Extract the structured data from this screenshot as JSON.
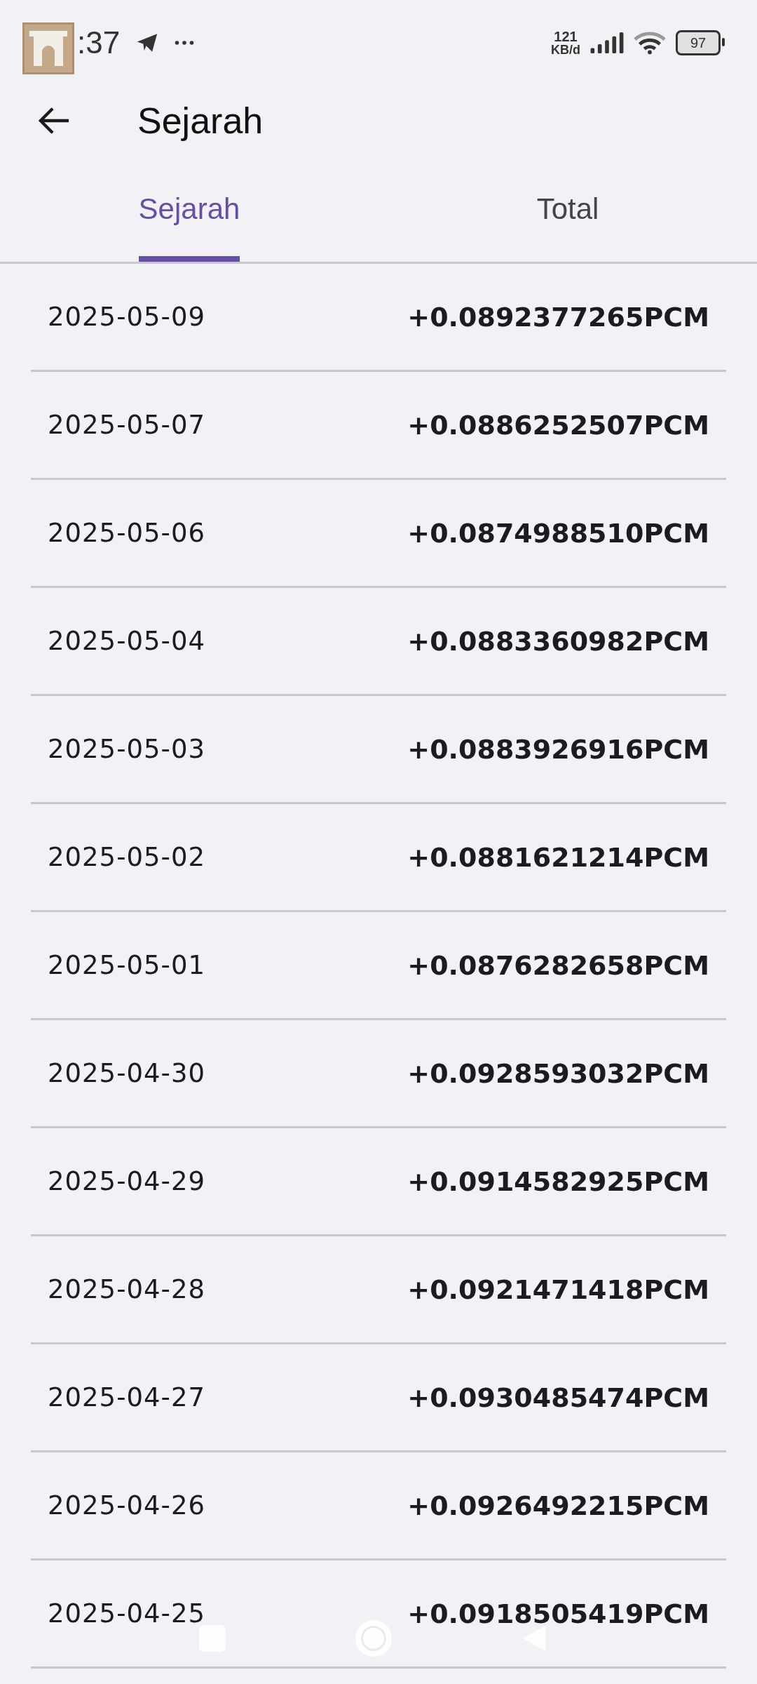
{
  "status_bar": {
    "time": ":37",
    "net_speed": "121",
    "net_unit": "KB/d",
    "battery": "97"
  },
  "toolbar": {
    "title": "Sejarah"
  },
  "tabs": [
    {
      "label": "Sejarah",
      "selected": true
    },
    {
      "label": "Total",
      "selected": false
    }
  ],
  "rows": [
    {
      "date": "2025-05-09",
      "amount": "+0.0892377265PCM"
    },
    {
      "date": "2025-05-07",
      "amount": "+0.0886252507PCM"
    },
    {
      "date": "2025-05-06",
      "amount": "+0.0874988510PCM"
    },
    {
      "date": "2025-05-04",
      "amount": "+0.0883360982PCM"
    },
    {
      "date": "2025-05-03",
      "amount": "+0.0883926916PCM"
    },
    {
      "date": "2025-05-02",
      "amount": "+0.0881621214PCM"
    },
    {
      "date": "2025-05-01",
      "amount": "+0.0876282658PCM"
    },
    {
      "date": "2025-04-30",
      "amount": "+0.0928593032PCM"
    },
    {
      "date": "2025-04-29",
      "amount": "+0.0914582925PCM"
    },
    {
      "date": "2025-04-28",
      "amount": "+0.0921471418PCM"
    },
    {
      "date": "2025-04-27",
      "amount": "+0.0930485474PCM"
    },
    {
      "date": "2025-04-26",
      "amount": "+0.0926492215PCM"
    },
    {
      "date": "2025-04-25",
      "amount": "+0.0918505419PCM"
    }
  ]
}
